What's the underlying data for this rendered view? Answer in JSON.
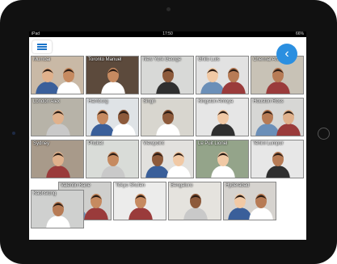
{
  "statusbar": {
    "left": "iPad",
    "time": "17:50",
    "right": "66%"
  },
  "nav": {
    "back_glyph": "‹"
  },
  "tiles": [
    {
      "label": "Mumbai",
      "bg": "#c9b9a6"
    },
    {
      "label": "Toronto Manuel",
      "bg": "#5c4a3c"
    },
    {
      "label": "New York George",
      "bg": "#d8d9d7"
    },
    {
      "label": "Ghilo Luis",
      "bg": "#e2e2e2"
    },
    {
      "label": "Chennai Anita",
      "bg": "#c8c2b6"
    },
    {
      "label": "London Alex",
      "bg": "#b7b3a8"
    },
    {
      "label": "Hamburg",
      "bg": "#dfe3e6"
    },
    {
      "label": "Singh",
      "bg": "#d8d6cf"
    },
    {
      "label": "Kingston Amoya",
      "bg": "#e6e6e6"
    },
    {
      "label": "Houston Ross",
      "bg": "#d7d7d5"
    },
    {
      "label": "Sydney",
      "bg": "#a89a8a"
    },
    {
      "label": "Phuket",
      "bg": "#d9dcd8"
    },
    {
      "label": "Viewpoint",
      "bg": "#e2e1de"
    },
    {
      "label": "Le Puit Lionel",
      "bg": "#94a48a"
    },
    {
      "label": "Tehini Lumpur",
      "bg": "#e7e7e7"
    },
    {
      "label": "Valentin Kane",
      "bg": "#cfcfcd"
    },
    {
      "label": "Tokyo Shufen",
      "bg": "#ececeb"
    },
    {
      "label": "Bengaluru",
      "bg": "#e5e3de"
    },
    {
      "label": "Hyderabad",
      "bg": "#d6d3cf"
    },
    {
      "label": "Kaohsiung",
      "bg": "#cfd0cf"
    }
  ]
}
